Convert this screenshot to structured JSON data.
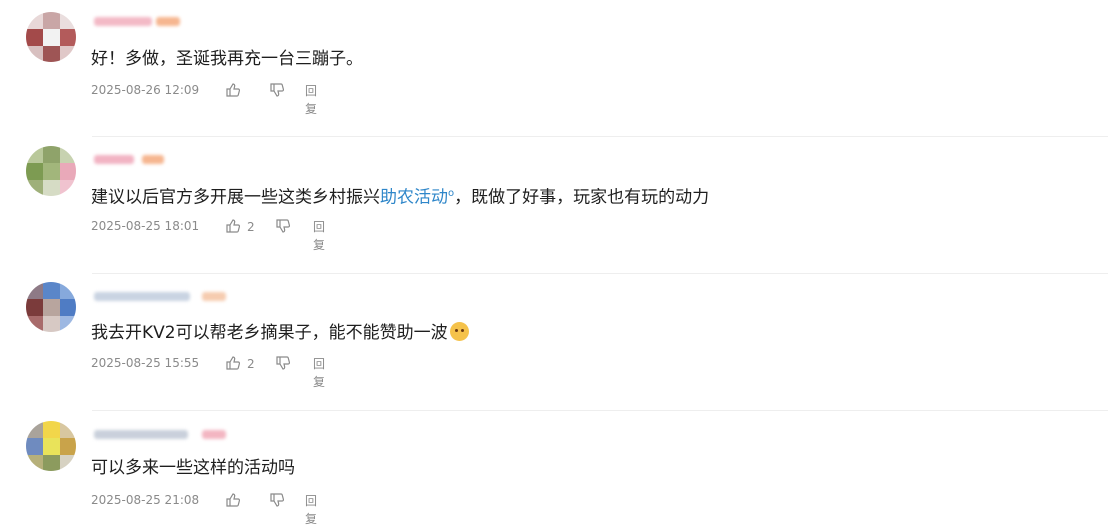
{
  "comments": [
    {
      "text": "好！多做，圣诞我再充一台三蹦子。",
      "time": "2025-08-26 12:09",
      "likes": "",
      "reply_label": "回复"
    },
    {
      "text_before": "建议以后官方多开展一些这类乡村振兴",
      "link": "助农活动",
      "link_mark": "o",
      "text_after": "，既做了好事，玩家也有玩的动力",
      "time": "2025-08-25 18:01",
      "likes": "2",
      "reply_label": "回复"
    },
    {
      "text": "我去开KV2可以帮老乡摘果子，能不能赞助一波",
      "emoji": "cat-face-icon",
      "time": "2025-08-25 15:55",
      "likes": "2",
      "reply_label": "回复"
    },
    {
      "text": "可以多来一些这样的活动吗",
      "time": "2025-08-25 21:08",
      "likes": "",
      "reply_label": "回复"
    }
  ],
  "icons": {
    "like": "thumbs-up-icon",
    "dislike": "thumbs-down-icon",
    "reply": "reply-icon"
  },
  "colors": {
    "link": "#2e86c9",
    "meta_text": "#8a8a8a",
    "divider": "#eeeeee"
  }
}
